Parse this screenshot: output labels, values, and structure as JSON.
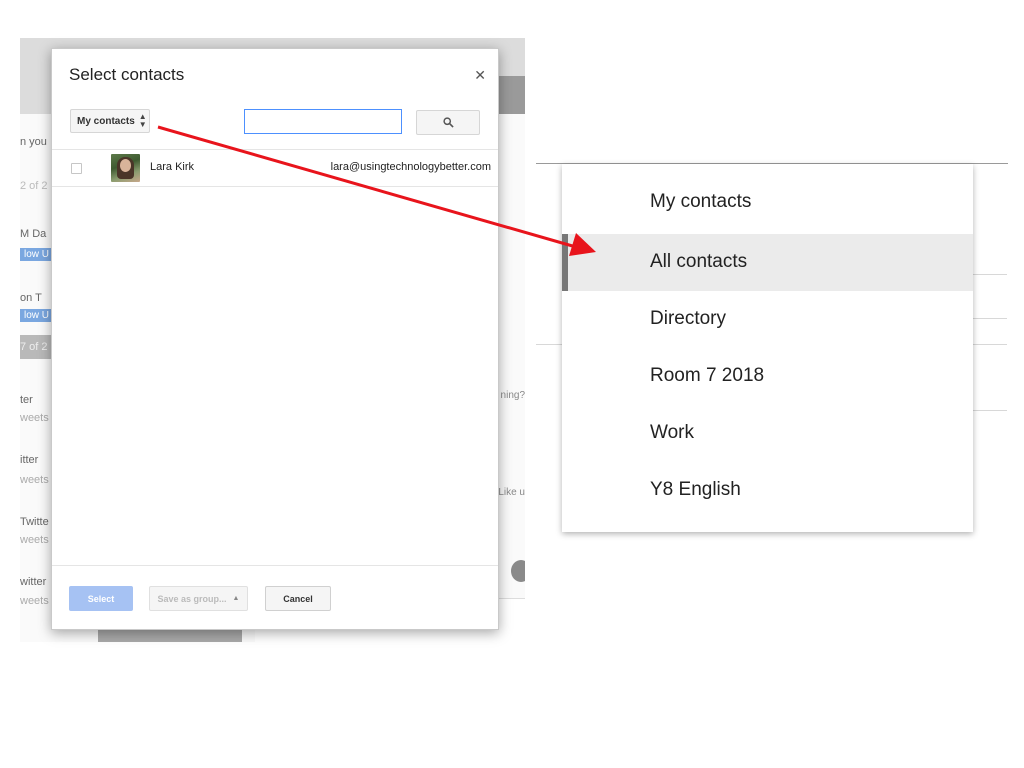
{
  "background": {
    "row_snippets": [
      "n you",
      "2 of 2",
      "M Da",
      "low U",
      "on T",
      "low U",
      "7 of 2",
      "ter",
      "weets",
      "itter",
      "weets",
      "Twitte",
      "weets",
      "witter",
      "weets"
    ],
    "right_snippets": [
      "ning?",
      "Like u"
    ]
  },
  "dialog": {
    "title": "Select contacts",
    "close_icon": "close-icon",
    "source_selector": {
      "value": "My contacts",
      "icon": "up-down-arrows-icon"
    },
    "search": {
      "value": "",
      "placeholder": ""
    },
    "search_button_icon": "search-icon",
    "contacts": [
      {
        "name": "Lara Kirk",
        "email": "lara@usingtechnologybetter.com",
        "checked": false
      }
    ],
    "buttons": {
      "select": "Select",
      "save_as_group": "Save as group...",
      "save_as_group_icon": "caret-up-icon",
      "cancel": "Cancel"
    }
  },
  "dropdown": {
    "items": [
      {
        "label": "My contacts",
        "active": false
      },
      {
        "label": "All contacts",
        "active": true
      },
      {
        "label": "Directory",
        "active": false
      },
      {
        "label": "Room 7 2018",
        "active": false
      },
      {
        "label": "Work",
        "active": false
      },
      {
        "label": "Y8 English",
        "active": false
      }
    ]
  },
  "colors": {
    "arrow": "#e8141c",
    "primary_button": "#a6c2f3",
    "focus_border": "#4d90fe",
    "active_item": "#ebebeb"
  }
}
